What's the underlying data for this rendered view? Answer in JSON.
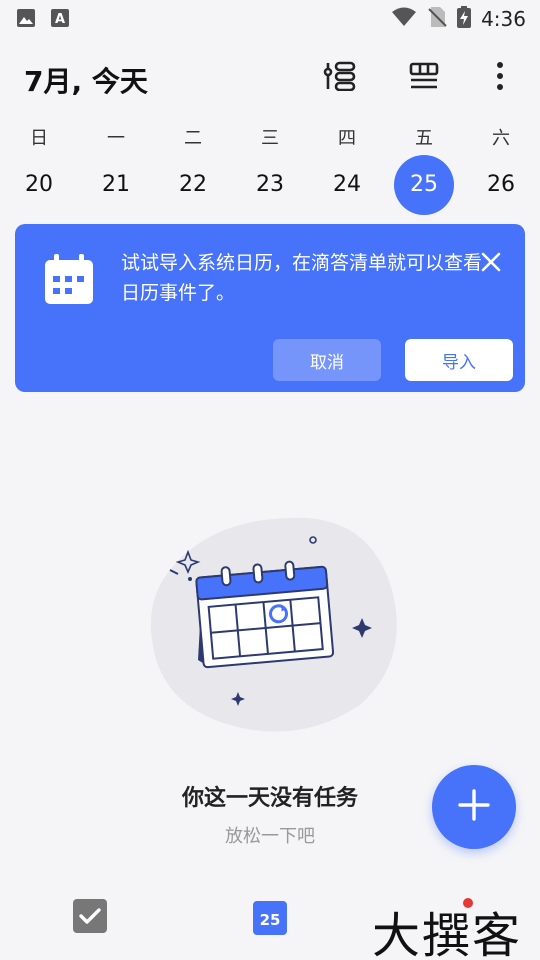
{
  "status_bar": {
    "time": "4:36"
  },
  "header": {
    "title": "7月, 今天",
    "icons": [
      "filter-icon",
      "view-toggle-icon",
      "more-icon"
    ]
  },
  "week": {
    "labels": [
      "日",
      "一",
      "二",
      "三",
      "四",
      "五",
      "六"
    ],
    "dates": [
      "20",
      "21",
      "22",
      "23",
      "24",
      "25",
      "26"
    ],
    "selected_index": 5
  },
  "banner": {
    "text": "试试导入系统日历，在滴答清单就可以查看日历事件了。",
    "cancel_label": "取消",
    "import_label": "导入"
  },
  "empty_state": {
    "title": "你这一天没有任务",
    "subtitle": "放松一下吧"
  },
  "bottom_nav": {
    "calendar_badge": "25"
  },
  "watermark": {
    "text": "大撰客"
  },
  "colors": {
    "accent": "#4772FA",
    "background": "#f5f5f7"
  }
}
